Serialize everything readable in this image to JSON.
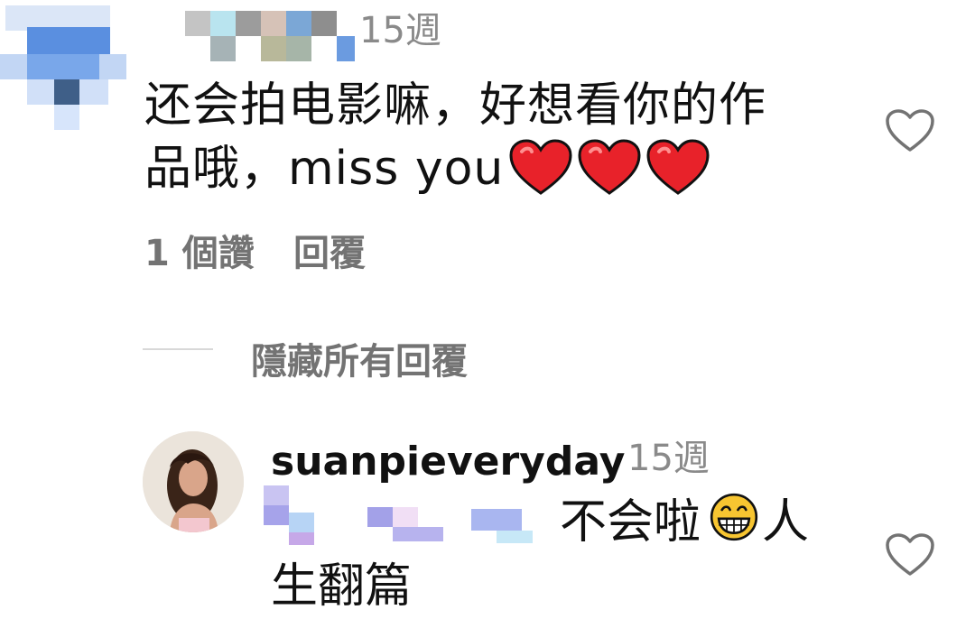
{
  "comment1": {
    "time": "15週",
    "text": "还会拍电影嘛，好想看你的作",
    "text_line2": "品哦，miss you",
    "emoji": "red-heart",
    "likes": "1 個讚",
    "reply": "回覆"
  },
  "hide_replies": "隱藏所有回覆",
  "comment2": {
    "username": "suanpieveryday",
    "time": "15週",
    "text_part1": "不会啦",
    "text_part2": "人",
    "text_line2": "生翻篇",
    "emoji": "grinning-face"
  },
  "colors": {
    "meta_gray": "#737373",
    "time_gray": "#8a8a8a",
    "heart_red": "#e8222a",
    "emoji_yellow": "#f7c531"
  }
}
